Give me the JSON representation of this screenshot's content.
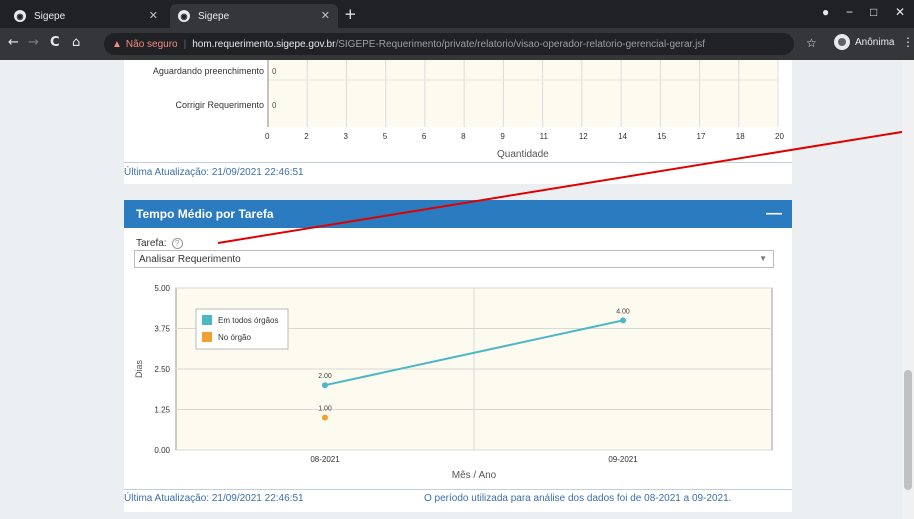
{
  "browser": {
    "tabs": [
      {
        "title": "Sigepe"
      },
      {
        "title": "Sigepe"
      }
    ],
    "new_tab": "+",
    "window_controls": [
      "−",
      "□",
      "✕"
    ],
    "nav": {
      "back": "←",
      "forward": "→",
      "reload": "C",
      "home": "⌂"
    },
    "address": {
      "security_label": "Não seguro",
      "host": "hom.requerimento.sigepe.gov.br",
      "path": "/SIGEPE-Requerimento/private/relatorio/visao-operador-relatorio-gerencial-gerar.jsf"
    },
    "profile_label": "Anônima"
  },
  "panel1": {
    "rows": [
      "Aguardando preenchimento",
      "Corrigir Requerimento"
    ],
    "row_values": [
      "0",
      "0"
    ],
    "x_ticks": [
      "0",
      "2",
      "3",
      "5",
      "6",
      "8",
      "9",
      "11",
      "12",
      "14",
      "15",
      "17",
      "18",
      "20"
    ],
    "x_title": "Quantidade",
    "updated": "Última Atualização: 21/09/2021 22:46:51"
  },
  "panel2": {
    "title": "Tempo Médio por Tarefa",
    "collapse_label": "—",
    "tarefa_label": "Tarefa:",
    "help_label": "?",
    "select_value": "Analisar Requerimento",
    "updated": "Última Atualização: 21/09/2021 22:46:51",
    "period_note": "O período utilizada para análise dos dados foi de 08-2021 a 09-2021."
  },
  "chart_data": {
    "type": "line",
    "categories": [
      "08-2021",
      "09-2021"
    ],
    "series": [
      {
        "name": "Em todos órgãos",
        "values": [
          2.0,
          4.0
        ],
        "labels": [
          "2.00",
          "4.00"
        ],
        "color": "#4bb8c4"
      },
      {
        "name": "No órgão",
        "values": [
          1.0,
          null
        ],
        "labels": [
          "1.00",
          ""
        ],
        "color": "#f0a030"
      }
    ],
    "xlabel": "Mês / Ano",
    "ylabel": "Dias",
    "ylim": [
      0,
      5
    ],
    "y_ticks": [
      "0.00",
      "1.25",
      "2.50",
      "3.75",
      "5.00"
    ],
    "legend_position": "top-left",
    "grid": true
  },
  "colors": {
    "header_blue": "#2a7bbf",
    "plot_bg": "#fdfaf0",
    "link_blue": "#3a6fa8",
    "annotation_red": "#e00000"
  }
}
